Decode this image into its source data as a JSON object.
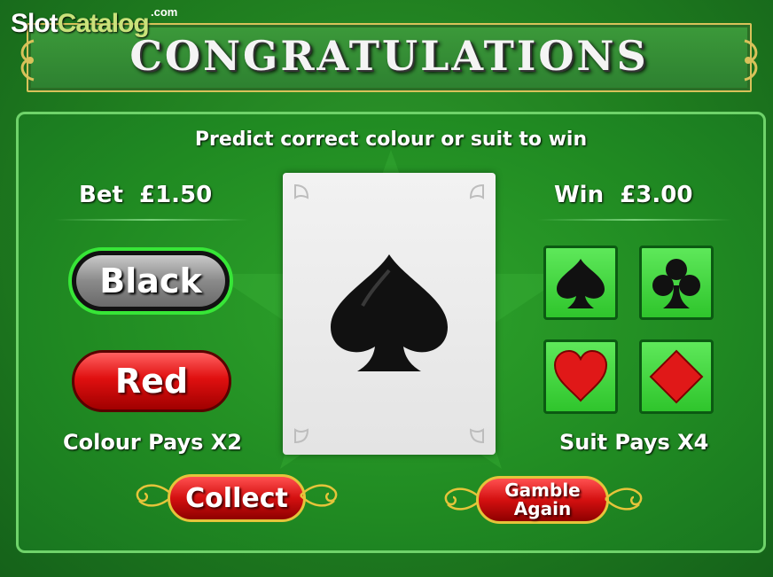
{
  "brand": {
    "part1": "Slot",
    "part2": "Catalog",
    "suffix": ".com"
  },
  "title": "CONGRATULATIONS",
  "instruction": "Predict correct colour or suit to win",
  "bet": {
    "label": "Bet",
    "amount": "£1.50"
  },
  "win": {
    "label": "Win",
    "amount": "£3.00"
  },
  "colour_buttons": {
    "black": "Black",
    "red": "Red"
  },
  "colour_pays": "Colour Pays X2",
  "suit_pays": "Suit Pays X4",
  "card": {
    "suit": "spade-icon",
    "color": "#111111"
  },
  "suits": [
    "spade-icon",
    "club-icon",
    "heart-icon",
    "diamond-icon"
  ],
  "actions": {
    "collect": "Collect",
    "gamble_line1": "Gamble",
    "gamble_line2": "Again"
  },
  "colors": {
    "table_green": "#208a22",
    "highlight": "#37e637",
    "red_button": "#e01010",
    "gold": "#e5c43a"
  }
}
